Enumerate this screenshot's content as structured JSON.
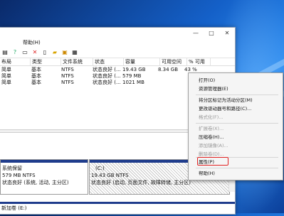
{
  "menubar": {
    "items": [
      "帮助(H)"
    ]
  },
  "window_buttons": {
    "minimize": "—",
    "maximize": "□",
    "close": "✕"
  },
  "volume_table": {
    "headers": [
      "布局",
      "类型",
      "文件系统",
      "状态",
      "容量",
      "可用空间",
      "% 可用"
    ],
    "rows": [
      [
        "简单",
        "基本",
        "NTFS",
        "状态良好 (...",
        "19.43 GB",
        "8.34 GB",
        "43 %"
      ],
      [
        "简单",
        "基本",
        "NTFS",
        "状态良好 (...",
        "579 MB",
        "",
        ""
      ],
      [
        "简单",
        "基本",
        "NTFS",
        "状态良好 (...",
        "1021 MB",
        "",
        ""
      ]
    ]
  },
  "disk0": {
    "partition1": {
      "name": "系统保留",
      "size": "579 MB NTFS",
      "status": "状态良好 (系统, 活动, 主分区)"
    },
    "partition2": {
      "name": "(C:)",
      "size": "19.43 GB NTFS",
      "status": "状态良好 (启动, 页面文件, 故障转储, 主分区)"
    }
  },
  "disk1": {
    "label": "新加卷 (E:)"
  },
  "context_menu": {
    "items": [
      {
        "label": "打开(O)",
        "enabled": true
      },
      {
        "label": "资源管理器(E)",
        "enabled": true
      },
      {
        "label": "将分区标记为活动分区(M)",
        "enabled": true
      },
      {
        "label": "更改驱动器号和路径(C)...",
        "enabled": true
      },
      {
        "label": "格式化(F)...",
        "enabled": false
      },
      {
        "label": "扩展卷(X)...",
        "enabled": false
      },
      {
        "label": "压缩卷(H)...",
        "enabled": true
      },
      {
        "label": "添加镜像(A)...",
        "enabled": false
      },
      {
        "label": "删除卷(D)...",
        "enabled": false
      },
      {
        "label": "属性(P)",
        "enabled": true
      },
      {
        "label": "帮助(H)",
        "enabled": true
      }
    ]
  },
  "colors": {
    "desktop": "#1460c8",
    "disk_bar": "#1f3c8c",
    "highlight": "#e02020"
  }
}
